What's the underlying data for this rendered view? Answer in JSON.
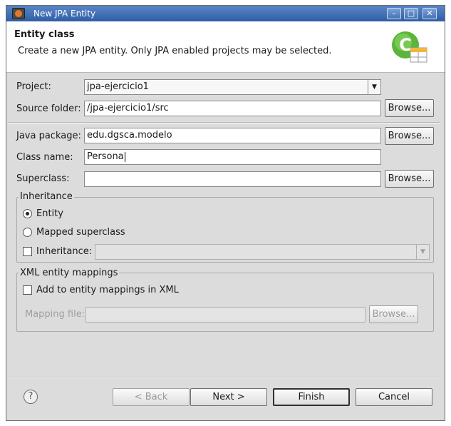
{
  "window": {
    "title": "New JPA Entity",
    "controls": {
      "minimize": "–",
      "maximize": "□",
      "close": "✕"
    },
    "icon": "eclipse-app-icon"
  },
  "banner": {
    "heading": "Entity class",
    "description": "Create a new JPA entity. Only JPA enabled projects may be selected.",
    "icon": "new-class-wizard-icon"
  },
  "form": {
    "project": {
      "label": "Project:",
      "value": "jpa-ejercicio1"
    },
    "source_folder": {
      "label": "Source folder:",
      "value": "/jpa-ejercicio1/src",
      "browse": "Browse..."
    },
    "java_package": {
      "label": "Java package:",
      "value": "edu.dgsca.modelo",
      "browse": "Browse..."
    },
    "class_name": {
      "label": "Class name:",
      "value": "Persona"
    },
    "superclass": {
      "label": "Superclass:",
      "value": "",
      "browse": "Browse..."
    }
  },
  "inheritance": {
    "title": "Inheritance",
    "entity_label": "Entity",
    "mapped_superclass_label": "Mapped superclass",
    "inheritance_label": "Inheritance:",
    "selected": "Entity"
  },
  "xml_mappings": {
    "title": "XML entity mappings",
    "add_label": "Add to entity mappings in XML",
    "mapping_file_label": "Mapping file:",
    "mapping_file_value": "",
    "browse": "Browse..."
  },
  "footer": {
    "help": "?",
    "back": "< Back",
    "next": "Next >",
    "finish": "Finish",
    "cancel": "Cancel"
  }
}
